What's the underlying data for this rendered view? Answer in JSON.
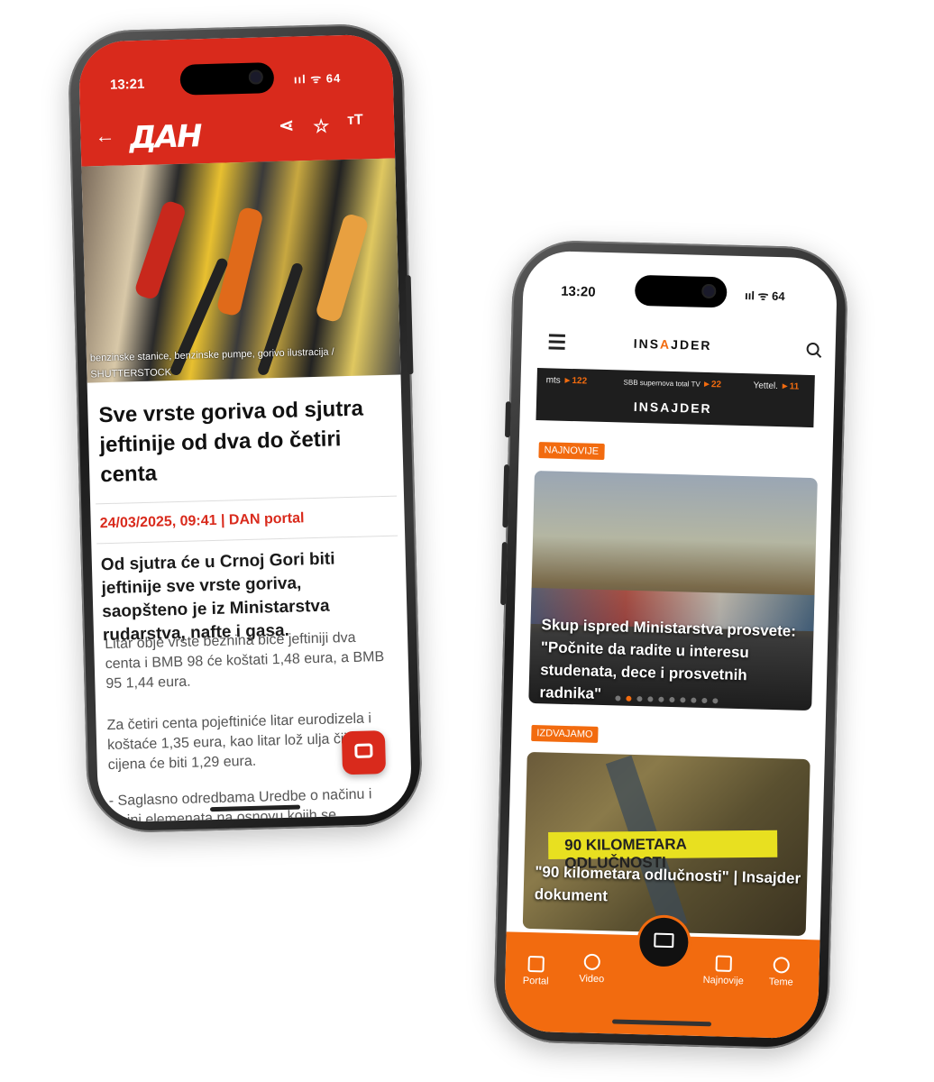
{
  "phone_dan": {
    "status_time": "13:21",
    "status_right": "ııl ᯤ 64",
    "logo": "ДАН",
    "icons": {
      "back": "back-arrow-icon",
      "share": "share-icon",
      "star": "star-icon",
      "text_size": "text-size-icon"
    },
    "image_caption": "benzinske stanice, benzinske pumpe, gorivo ilustracija / SHUTTERSTOCK",
    "headline": "Sve vrste goriva od sjutra jeftinije od dva do četiri centa",
    "meta": "24/03/2025, 09:41 | DAN portal",
    "lead": "Od sjutra će u Crnoj Gori biti jeftinije sve vrste goriva, saopšteno je iz Ministarstva rudarstva, nafte i gasa.",
    "paragraphs": [
      "Litar obje vrste beznina biće jeftiniji dva centa i BMB 98 će koštati 1,48 eura, a BMB 95  1,44 eura.",
      "Za četiri centa pojeftiniće litar eurodizela i koštaće 1,35 eura, kao litar lož ulja čija cijena će biti 1,29 eura.",
      "- Saglasno odredbama Uredbe o načinu i visini elemenata na osnovu kojih se"
    ],
    "accent": "#d92a1c"
  },
  "phone_insajder": {
    "status_time": "13:20",
    "status_right": "ııl ᯤ 64",
    "logo_left": "INS",
    "logo_mid": "A",
    "logo_right": "JDER",
    "banner": {
      "mts": "mts",
      "mts_num": "►122",
      "sbb": "SBB supernova total TV",
      "sbb_num": "►22",
      "yettel": "Yettel.",
      "yettel_num": "►11",
      "title": "INSAJDER"
    },
    "section_latest": "NAJNOVIJE",
    "card1_title": "Skup ispred Ministarstva prosvete: \"Počnite da radite u interesu studenata, dece i prosvetnih radnika\"",
    "carousel_pages": 10,
    "carousel_active": 2,
    "section_featured": "IZDVAJAMO",
    "card2_band": "90 KILOMETARA  ODLUČNOSTI",
    "card2_title": "\"90 kilometara odlučnosti\" | Insajder dokument",
    "nav": [
      "Portal",
      "Video",
      "Najnovije",
      "Teme"
    ],
    "accent": "#f26b0f"
  }
}
